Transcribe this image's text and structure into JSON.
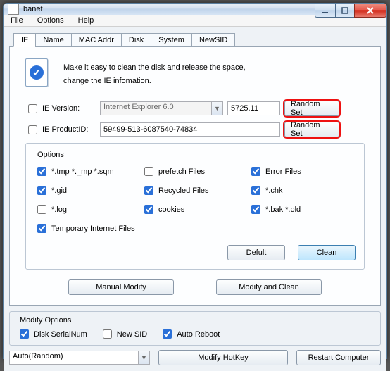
{
  "window": {
    "title": "banet"
  },
  "menu": {
    "file": "File",
    "options": "Options",
    "help": "Help"
  },
  "tabs": {
    "ie": "IE",
    "name": "Name",
    "mac": "MAC Addr",
    "disk": "Disk",
    "system": "System",
    "newsid": "NewSID"
  },
  "intro": {
    "line1": "Make it easy to clean the disk and release the space,",
    "line2": "change the IE infomation."
  },
  "ie": {
    "version_label": "IE Version:",
    "version_value": "Internet Explorer 6.0",
    "version_num": "5725.11",
    "productid_label": "IE ProductID:",
    "productid_value": "59499-513-6087540-74834",
    "random_set": "Random Set"
  },
  "options": {
    "legend": "Options",
    "tmp": "*.tmp  *._mp  *.sqm",
    "gid": "*.gid",
    "log": "*.log",
    "temp_internet": "Temporary Internet Files",
    "prefetch": "prefetch Files",
    "recycled": "Recycled Files",
    "cookies": "cookies",
    "error": "Error Files",
    "chk": "*.chk",
    "bakold": "*.bak  *.old",
    "default_btn": "Defult",
    "clean_btn": "Clean"
  },
  "actions": {
    "manual_modify": "Manual Modify",
    "modify_clean": "Modify and Clean"
  },
  "modify": {
    "legend": "Modify Options",
    "disk_serial": "Disk SerialNum",
    "new_sid": "New SID",
    "auto_reboot": "Auto Reboot"
  },
  "bottom": {
    "auto_value": "Auto(Random)",
    "hotkey": "Modify HotKey",
    "restart": "Restart Computer"
  }
}
